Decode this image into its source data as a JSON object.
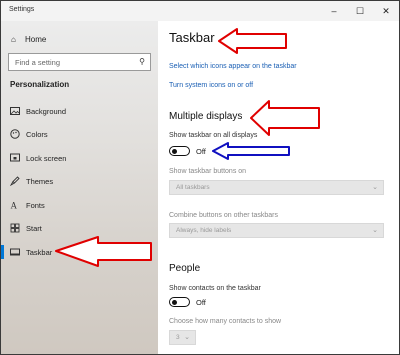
{
  "window": {
    "title": "Settings",
    "controls": {
      "minimize": "–",
      "maximize": "☐",
      "close": "✕"
    }
  },
  "sidebar": {
    "home": "Home",
    "search_placeholder": "Find a setting",
    "section": "Personalization",
    "items": [
      {
        "label": "Background",
        "icon": "picture-icon"
      },
      {
        "label": "Colors",
        "icon": "palette-icon"
      },
      {
        "label": "Lock screen",
        "icon": "lock-screen-icon"
      },
      {
        "label": "Themes",
        "icon": "brush-icon"
      },
      {
        "label": "Fonts",
        "icon": "fonts-icon"
      },
      {
        "label": "Start",
        "icon": "start-icon"
      },
      {
        "label": "Taskbar",
        "icon": "taskbar-icon",
        "active": true
      }
    ]
  },
  "main": {
    "title": "Taskbar",
    "links": {
      "select_icons": "Select which icons appear on the taskbar",
      "system_icons": "Turn system icons on or off"
    },
    "multiple_displays": {
      "heading": "Multiple displays",
      "show_on_all_label": "Show taskbar on all displays",
      "show_on_all_state": "Off",
      "buttons_on_label": "Show taskbar buttons on",
      "buttons_on_value": "All taskbars",
      "combine_label": "Combine buttons on other taskbars",
      "combine_value": "Always, hide labels"
    },
    "people": {
      "heading": "People",
      "contacts_label": "Show contacts on the taskbar",
      "contacts_state": "Off",
      "how_many_label": "Choose how many contacts to show",
      "how_many_value": "3"
    }
  },
  "colors": {
    "accent": "#0078d7",
    "link": "#1a5fb4",
    "annotation_red": "#e00000",
    "annotation_blue": "#1010c0"
  }
}
